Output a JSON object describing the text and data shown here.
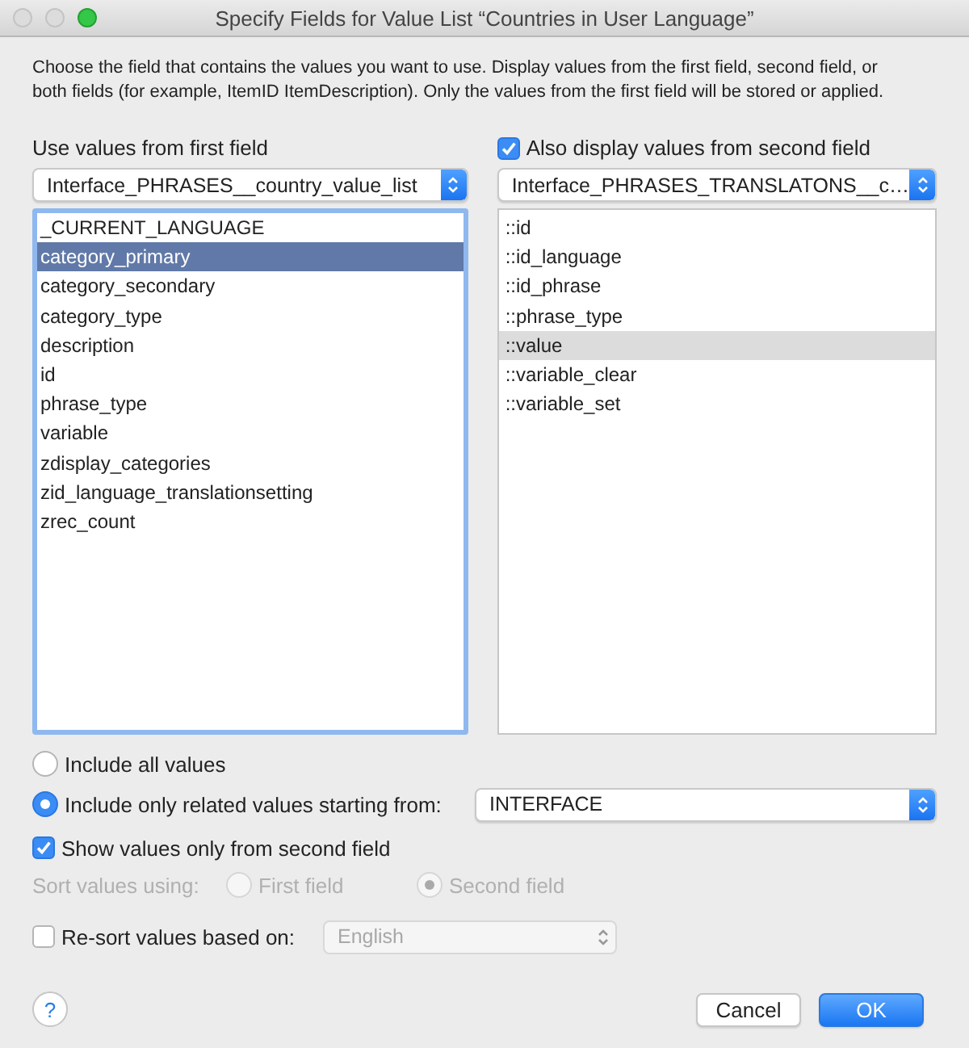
{
  "window": {
    "title": "Specify Fields for Value List “Countries in User Language”",
    "buttons": [
      {
        "kind": "close",
        "disabled": true
      },
      {
        "kind": "minimize",
        "disabled": true
      },
      {
        "kind": "zoom",
        "disabled": false
      }
    ]
  },
  "description": "Choose the field that contains the values you want to use.  Display values from the first field, second field, or both fields (for example, ItemID ItemDescription). Only the values from the first field will be stored or applied.",
  "first_field": {
    "label": "Use values from first field",
    "popup": {
      "value": "Interface_PHRASES__country_value_list"
    },
    "focused": true,
    "items": [
      {
        "label": "_CURRENT_LANGUAGE",
        "selected": false
      },
      {
        "label": "category_primary",
        "selected": true
      },
      {
        "label": "category_secondary",
        "selected": false
      },
      {
        "label": "category_type",
        "selected": false
      },
      {
        "label": "description",
        "selected": false
      },
      {
        "label": "id",
        "selected": false
      },
      {
        "label": "phrase_type",
        "selected": false
      },
      {
        "label": "variable",
        "selected": false
      },
      {
        "label": "zdisplay_categories",
        "selected": false
      },
      {
        "label": "zid_language_translationsetting",
        "selected": false
      },
      {
        "label": "zrec_count",
        "selected": false
      }
    ]
  },
  "second_field": {
    "checkbox": {
      "label": "Also display values from second field",
      "checked": true
    },
    "popup": {
      "value": "Interface_PHRASES_TRANSLATONS__c…"
    },
    "focused": false,
    "items": [
      {
        "label": "::id",
        "selected": false
      },
      {
        "label": "::id_language",
        "selected": false
      },
      {
        "label": "::id_phrase",
        "selected": false
      },
      {
        "label": "::phrase_type",
        "selected": false
      },
      {
        "label": "::value",
        "selected": true
      },
      {
        "label": "::variable_clear",
        "selected": false
      },
      {
        "label": "::variable_set",
        "selected": false
      }
    ]
  },
  "include_options": [
    {
      "label": "Include all values",
      "selected": false
    },
    {
      "label": "Include only related values starting from:",
      "selected": true
    }
  ],
  "related_popup": {
    "value": "INTERFACE"
  },
  "show_second_only": {
    "label": "Show values only from second field",
    "checked": true
  },
  "sort": {
    "label": "Sort values using:",
    "disabled": true,
    "options": [
      {
        "label": "First field",
        "selected": false
      },
      {
        "label": "Second field",
        "selected": true
      }
    ]
  },
  "resort": {
    "label": "Re-sort values based on:",
    "checked": false,
    "popup": {
      "value": "English",
      "disabled": true
    }
  },
  "help": {
    "label": "?"
  },
  "buttons": [
    {
      "label": "Cancel",
      "kind": "normal"
    },
    {
      "label": "OK",
      "kind": "default"
    }
  ]
}
